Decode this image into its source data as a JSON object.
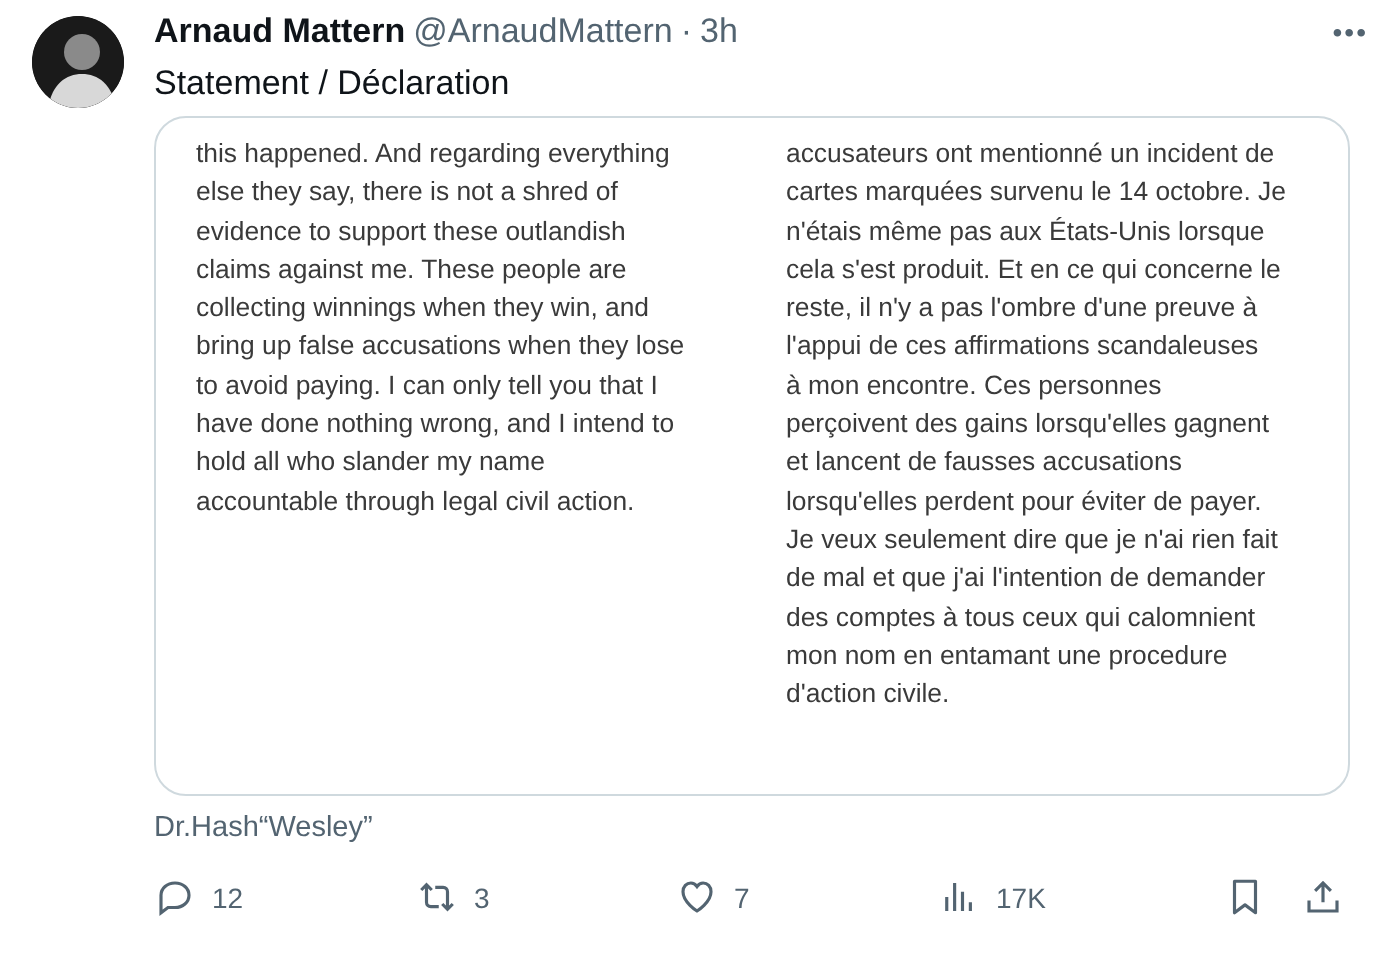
{
  "author": {
    "name": "Arnaud Mattern",
    "handle": "@ArnaudMattern",
    "separator": "·",
    "time": "3h"
  },
  "menu": "•••",
  "text": "Statement / Déclaration",
  "statement": {
    "columns": [
      "this happened. And regarding everything\nelse they say, there is not a shred of\nevidence to support these outlandish\nclaims against me. These people are\ncollecting winnings when they win, and\nbring up false accusations when they lose\nto avoid paying. I can only tell you that I\nhave done nothing wrong, and I intend to\nhold all who slander my name\naccountable through legal civil action.",
      "accusateurs ont mentionné un incident de\ncartes marquées survenu le 14 octobre. Je\nn'étais même pas aux États-Unis lorsque\ncela s'est produit. Et en ce qui concerne le\nreste, il n'y a pas l'ombre d'une preuve à\nl'appui de ces affirmations scandaleuses\nà mon encontre. Ces personnes\nperçoivent des gains lorsqu'elles gagnent\net lancent de fausses accusations\nlorsqu'elles perdent pour éviter de payer.\nJe veux seulement dire que je n'ai rien fait\nde mal et que j'ai l'intention de demander\ndes comptes à tous ceux qui calomnient\nmon nom en entamant une procedure\nd'action civile."
    ]
  },
  "caption": "Dr.Hash“Wesley”",
  "actions": [
    {
      "kind": "reply",
      "count": "12"
    },
    {
      "kind": "repost",
      "count": "3"
    },
    {
      "kind": "like",
      "count": "7"
    },
    {
      "kind": "views",
      "count": "17K"
    },
    {
      "kind": "bookmark"
    },
    {
      "kind": "share"
    }
  ]
}
